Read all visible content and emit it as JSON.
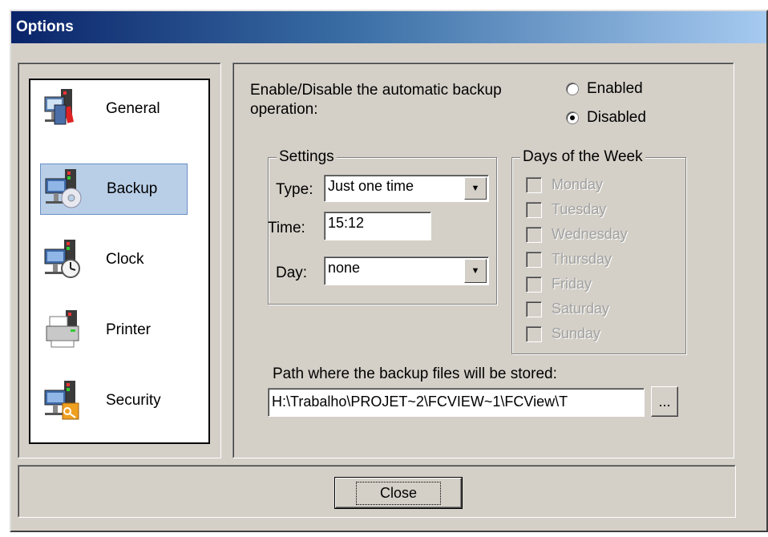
{
  "window": {
    "title": "Options"
  },
  "nav": {
    "items": [
      {
        "label": "General",
        "icon": "general-icon",
        "selected": false
      },
      {
        "label": "Backup",
        "icon": "backup-icon",
        "selected": true
      },
      {
        "label": "Clock",
        "icon": "clock-icon",
        "selected": false
      },
      {
        "label": "Printer",
        "icon": "printer-icon",
        "selected": false
      },
      {
        "label": "Security",
        "icon": "security-icon",
        "selected": false
      }
    ]
  },
  "backup": {
    "enable_prompt_line1": "Enable/Disable the automatic backup",
    "enable_prompt_line2": "operation:",
    "enabled_label": "Enabled",
    "disabled_label": "Disabled",
    "selected_mode": "Disabled",
    "settings": {
      "legend": "Settings",
      "type_label": "Type:",
      "type_value": "Just one time",
      "time_label": "Time:",
      "time_value": "15:12",
      "day_label": "Day:",
      "day_value": "none"
    },
    "days": {
      "legend": "Days of the Week",
      "items": [
        "Monday",
        "Tuesday",
        "Wednesday",
        "Thursday",
        "Friday",
        "Saturday",
        "Sunday"
      ]
    },
    "path_label": "Path where the backup files will be stored:",
    "path_value": "H:\\Trabalho\\PROJET~2\\FCVIEW~1\\FCView\\T",
    "browse_label": "..."
  },
  "footer": {
    "close_label": "Close"
  }
}
